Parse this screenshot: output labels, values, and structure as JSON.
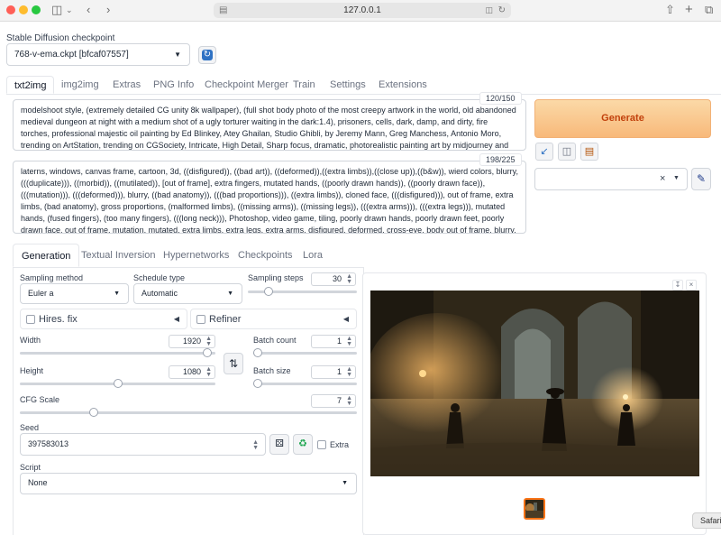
{
  "browser": {
    "url": "127.0.0.1",
    "tooltip": "Safari"
  },
  "checkpoint": {
    "label": "Stable Diffusion checkpoint",
    "value": "768-v-ema.ckpt [bfcaf07557]"
  },
  "tabs": [
    "txt2img",
    "img2img",
    "Extras",
    "PNG Info",
    "Checkpoint Merger",
    "Train",
    "Settings",
    "Extensions"
  ],
  "prompt": {
    "text": "modelshoot style, (extremely detailed CG unity 8k wallpaper), (full shot body photo of the most creepy artwork in the world, old abandoned medieval dungeon at night with a medium shot of a ugly torturer waiting in the dark:1.4), prisoners, cells, dark, damp, and dirty, fire torches, professional majestic oil painting by Ed Blinkey, Atey Ghailan, Studio Ghibli, by Jeremy Mann, Greg Manchess, Antonio Moro, trending on ArtStation, trending on CGSociety, Intricate, High Detail, Sharp focus, dramatic, photorealistic painting art by midjourney and greg rutkowski",
    "counter": "120/150"
  },
  "negative": {
    "text": "laterns, windows, canvas frame, cartoon, 3d, ((disfigured)), ((bad art)), ((deformed)),((extra limbs)),((close up)),((b&w)), wierd colors, blurry, (((duplicate))), ((morbid)), ((mutilated)), [out of frame], extra fingers, mutated hands, ((poorly drawn hands)), ((poorly drawn face)), (((mutation))), (((deformed))), blurry, ((bad anatomy)), (((bad proportions))), ((extra limbs)), cloned face, (((disfigured))), out of frame, extra limbs, (bad anatomy), gross proportions, (malformed limbs), ((missing arms)), ((missing legs)), (((extra arms))), (((extra legs))), mutated hands, (fused fingers), (too many fingers), (((long neck))), Photoshop, video game, tiling, poorly drawn hands, poorly drawn feet, poorly drawn face, out of frame, mutation, mutated, extra limbs, extra legs, extra arms, disfigured, deformed, cross-eye, body out of frame, blurry, bad art, bad anatomy, 3d render",
    "counter": "198/225"
  },
  "generate_label": "Generate",
  "subtabs": [
    "Generation",
    "Textual Inversion",
    "Hypernetworks",
    "Checkpoints",
    "Lora"
  ],
  "params": {
    "sampling_method_label": "Sampling method",
    "sampling_method": "Euler a",
    "schedule_type_label": "Schedule type",
    "schedule_type": "Automatic",
    "sampling_steps_label": "Sampling steps",
    "sampling_steps": "30",
    "hires_label": "Hires. fix",
    "refiner_label": "Refiner",
    "width_label": "Width",
    "width": "1920",
    "height_label": "Height",
    "height": "1080",
    "batch_count_label": "Batch count",
    "batch_count": "1",
    "batch_size_label": "Batch size",
    "batch_size": "1",
    "cfg_label": "CFG Scale",
    "cfg": "7",
    "seed_label": "Seed",
    "seed": "397583013",
    "extra_label": "Extra",
    "script_label": "Script",
    "script": "None"
  },
  "slider_levels": {
    "sampling_steps": 0.19,
    "width": 0.96,
    "height": 0.5,
    "batch_count": 0.0,
    "batch_size": 0.0,
    "cfg": 0.22
  },
  "colors": {
    "generate_bg": "#f8b97a",
    "generate_text": "#c2410c",
    "accent_blue": "#2f72c4",
    "thumb_border": "#f97316"
  },
  "icons": [
    "sidebar-icon",
    "back-icon",
    "forward-icon",
    "share-icon",
    "new-tab-icon",
    "tabs-icon",
    "refresh-icon",
    "paste-icon",
    "trash-icon",
    "notes-icon",
    "pencil-icon",
    "swap-icon",
    "dice-icon",
    "recycle-icon",
    "download-icon",
    "close-icon"
  ]
}
